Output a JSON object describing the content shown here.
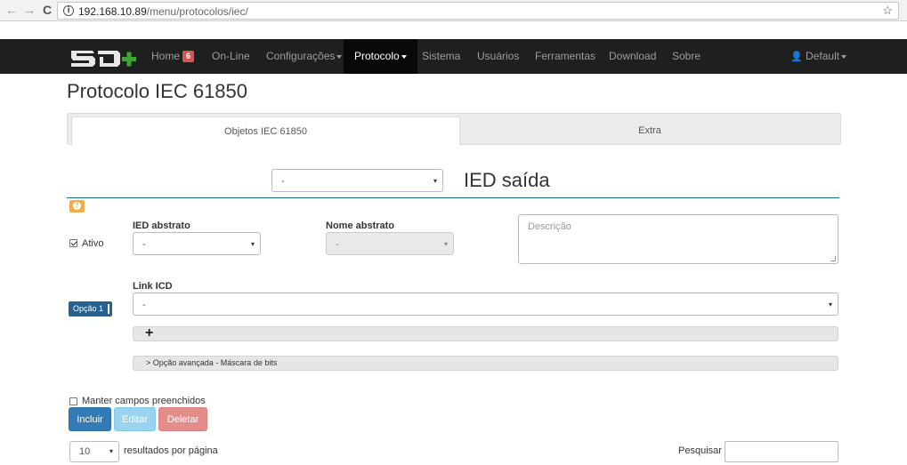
{
  "browser": {
    "back_glyph": "←",
    "forward_glyph": "→",
    "reload_glyph": "C",
    "info_glyph": "i",
    "url_host": "192.168.10.89",
    "url_path": "/menu/protocolos/iec/",
    "star_glyph": "☆"
  },
  "navbar": {
    "home": "Home",
    "home_badge": "6",
    "online": "On-Line",
    "configuracoes": "Configurações",
    "protocolo": "Protocolo",
    "sistema": "Sistema",
    "usuarios": "Usuários",
    "ferramentas": "Ferramentas",
    "download": "Download",
    "sobre": "Sobre",
    "user_icon_glyph": "👤",
    "user": "Default"
  },
  "page": {
    "title": "Protocolo IEC 61850",
    "tabs": [
      {
        "label": "Objetos IEC 61850"
      },
      {
        "label": "Extra"
      }
    ]
  },
  "form": {
    "ied_select_value": "-",
    "ied_title": "IED saída",
    "help_glyph": "?",
    "ativo_label": "Ativo",
    "ied_abstrato_label": "IED abstrato",
    "ied_abstrato_value": "-",
    "nome_abstrato_label": "Nome abstrato",
    "nome_abstrato_value": "-",
    "descricao_placeholder": "Descrição",
    "link_icd_label": "Link ICD",
    "link_icd_value": "-",
    "option_button": "Opção 1",
    "add_glyph": "+",
    "advanced_toggle": "> Opção avançada - Máscara de bits",
    "keep_fields_label": "Manter campos preenchidos",
    "incluir": "Incluir",
    "editar": "Editar",
    "deletar": "Deletar",
    "page_size": "10",
    "results_per_page": "resultados por página",
    "pesquisar": "Pesquisar"
  },
  "icons": {
    "caret": "▾",
    "help": "question-circle-icon",
    "user": "user-icon"
  },
  "colors": {
    "navbar_bg": "#1f1f1f",
    "primary": "#337ab7",
    "info": "#9ad3ee",
    "danger": "#e38d8a",
    "warning": "#f0ad4e",
    "logo_green": "#3fa535"
  }
}
